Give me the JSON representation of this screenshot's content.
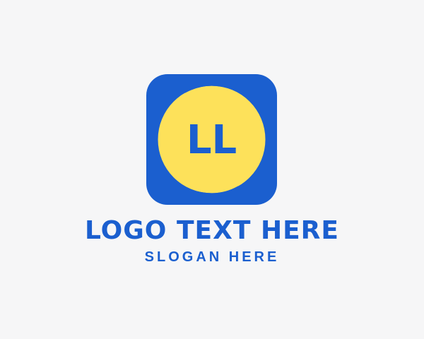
{
  "logo": {
    "monogram": "LL",
    "title": "LOGO TEXT HERE",
    "slogan": "SLOGAN HERE"
  },
  "colors": {
    "background": "#f6f6f7",
    "brand_blue": "#1b5fcf",
    "brand_yellow": "#fde15a"
  },
  "icons": {
    "emblem": "rounded-square-circle-monogram-icon"
  }
}
